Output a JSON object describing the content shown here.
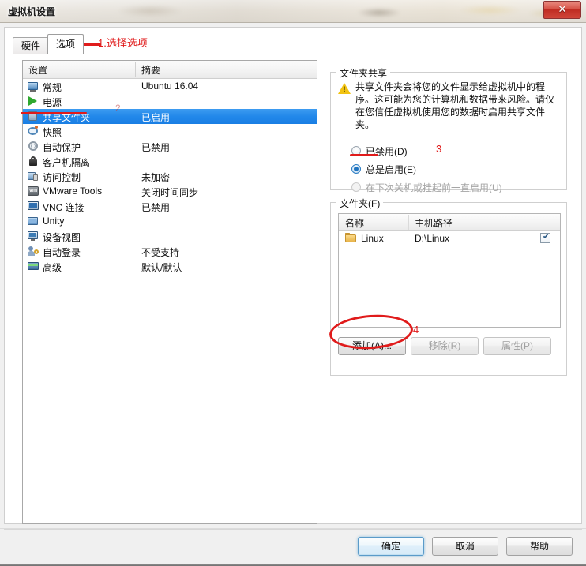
{
  "window": {
    "title": "虚拟机设置",
    "close_label": "✕"
  },
  "tabs": [
    {
      "label": "硬件",
      "active": false
    },
    {
      "label": "选项",
      "active": true
    }
  ],
  "settings_table": {
    "columns": [
      "设置",
      "摘要"
    ],
    "rows": [
      {
        "icon": "monitor-icon",
        "label": "常规",
        "summary": "Ubuntu 16.04",
        "selected": false
      },
      {
        "icon": "power-play-icon",
        "label": "电源",
        "summary": "",
        "selected": false
      },
      {
        "icon": "shared-folders-icon",
        "label": "共享文件夹",
        "summary": "已启用",
        "selected": true
      },
      {
        "icon": "snapshot-icon",
        "label": "快照",
        "summary": "",
        "selected": false
      },
      {
        "icon": "autoprotect-icon",
        "label": "自动保护",
        "summary": "已禁用",
        "selected": false
      },
      {
        "icon": "lock-icon",
        "label": "客户机隔离",
        "summary": "",
        "selected": false
      },
      {
        "icon": "access-control-icon",
        "label": "访问控制",
        "summary": "未加密",
        "selected": false
      },
      {
        "icon": "vmware-tools-icon",
        "label": "VMware Tools",
        "summary": "关闭时间同步",
        "selected": false
      },
      {
        "icon": "vnc-icon",
        "label": "VNC 连接",
        "summary": "已禁用",
        "selected": false
      },
      {
        "icon": "unity-icon",
        "label": "Unity",
        "summary": "",
        "selected": false
      },
      {
        "icon": "device-view-icon",
        "label": "设备视图",
        "summary": "",
        "selected": false
      },
      {
        "icon": "auto-login-icon",
        "label": "自动登录",
        "summary": "不受支持",
        "selected": false
      },
      {
        "icon": "advanced-icon",
        "label": "高级",
        "summary": "默认/默认",
        "selected": false
      }
    ]
  },
  "folder_sharing": {
    "group_title": "文件夹共享",
    "warning_icon": "warning-triangle-icon",
    "warning_text": "共享文件夹会将您的文件显示给虚拟机中的程序。这可能为您的计算机和数据带来风险。请仅在您信任虚拟机使用您的数据时启用共享文件夹。",
    "options": [
      {
        "label": "已禁用(D)",
        "checked": false,
        "disabled": false
      },
      {
        "label": "总是启用(E)",
        "checked": true,
        "disabled": false
      },
      {
        "label": "在下次关机或挂起前一直启用(U)",
        "checked": false,
        "disabled": true
      }
    ]
  },
  "folders": {
    "group_title": "文件夹(F)",
    "columns": [
      "名称",
      "主机路径",
      ""
    ],
    "rows": [
      {
        "icon": "folder-icon",
        "name": "Linux",
        "path": "D:\\Linux",
        "enabled": true,
        "check_mark": "✔"
      }
    ],
    "buttons": [
      {
        "label": "添加(A)...",
        "disabled": false
      },
      {
        "label": "移除(R)",
        "disabled": true
      },
      {
        "label": "属性(P)",
        "disabled": true
      }
    ]
  },
  "footer": {
    "ok": "确定",
    "cancel": "取消",
    "help": "帮助"
  },
  "annotations": {
    "step1": "1.选择选项",
    "step2": "2",
    "step3": "3",
    "step4": "4",
    "color": "#e01b1b"
  }
}
